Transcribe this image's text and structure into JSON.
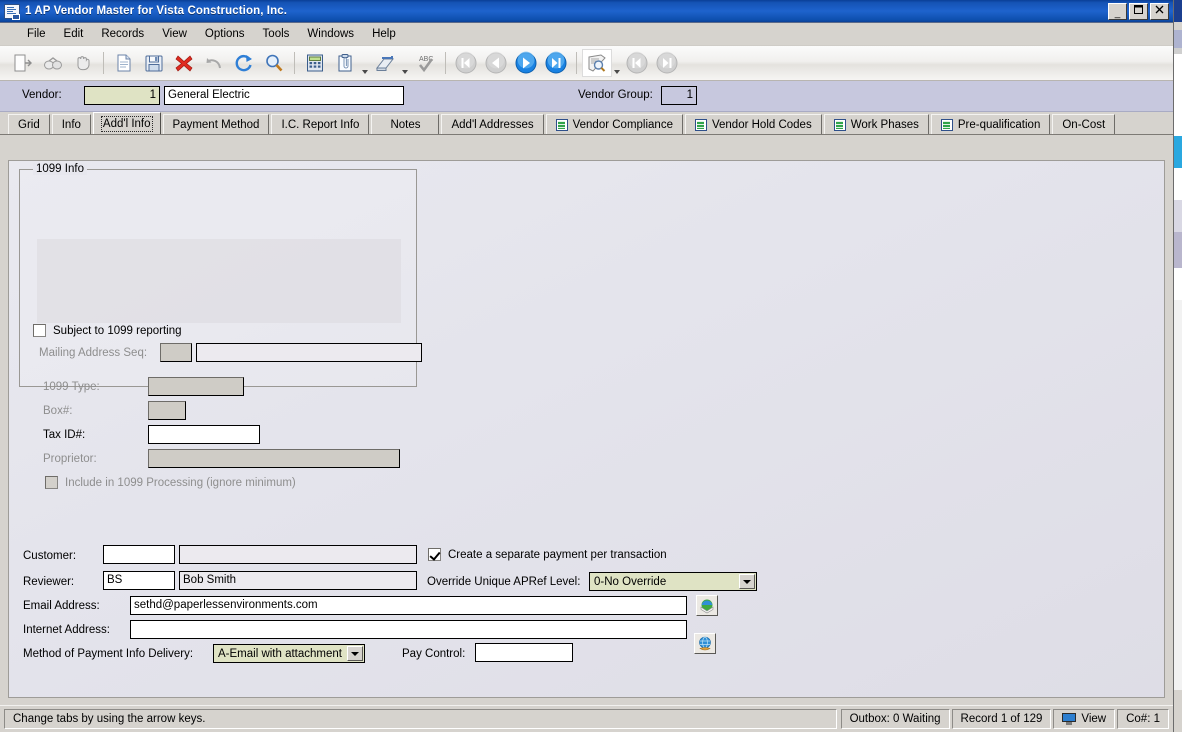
{
  "window": {
    "title": "1 AP Vendor Master for Vista Construction, Inc.",
    "icon": "form-window-icon",
    "buttons": {
      "minimize": "_",
      "maximize": "❐",
      "close": "✕"
    }
  },
  "menubar": {
    "items": [
      {
        "label": "File"
      },
      {
        "label": "Edit"
      },
      {
        "label": "Records"
      },
      {
        "label": "View"
      },
      {
        "label": "Options"
      },
      {
        "label": "Tools"
      },
      {
        "label": "Windows"
      },
      {
        "label": "Help"
      }
    ]
  },
  "toolbar": {
    "buttons": [
      {
        "name": "login-icon",
        "title": "Log In"
      },
      {
        "name": "binoculars-icon",
        "title": "Find"
      },
      {
        "name": "hand-stop-icon",
        "title": "Stop"
      },
      {
        "name": "new-document-icon",
        "title": "New"
      },
      {
        "name": "save-icon",
        "title": "Save"
      },
      {
        "name": "delete-icon",
        "title": "Delete"
      },
      {
        "name": "undo-icon",
        "title": "Undo"
      },
      {
        "name": "refresh-icon",
        "title": "Refresh"
      },
      {
        "name": "search-icon",
        "title": "Search"
      },
      {
        "name": "calculator-icon",
        "title": "Calculator"
      },
      {
        "name": "clipboard-icon",
        "title": "Notes"
      },
      {
        "name": "scanner-icon",
        "title": "Attachments"
      },
      {
        "name": "spellcheck-icon",
        "title": "Spell Check"
      },
      {
        "name": "first-record-icon",
        "title": "First Record"
      },
      {
        "name": "previous-record-icon",
        "title": "Previous Record"
      },
      {
        "name": "next-record-icon",
        "title": "Next Record"
      },
      {
        "name": "last-record-icon",
        "title": "Last Record"
      },
      {
        "name": "preview-icon",
        "title": "Preview"
      },
      {
        "name": "first-page-icon",
        "title": "First Page"
      },
      {
        "name": "last-page-icon",
        "title": "Last Page"
      }
    ]
  },
  "header": {
    "vendor_label": "Vendor:",
    "vendor_number": "1",
    "vendor_name": "General Electric",
    "vendor_group_label": "Vendor Group:",
    "vendor_group": "1"
  },
  "tabs": [
    {
      "label": "Grid",
      "icon": null,
      "active": false
    },
    {
      "label": "Info",
      "icon": null,
      "active": false
    },
    {
      "label": "Add'l Info",
      "icon": null,
      "active": true
    },
    {
      "label": "Payment Method",
      "icon": null,
      "active": false
    },
    {
      "label": "I.C. Report Info",
      "icon": null,
      "active": false
    },
    {
      "label": "Notes",
      "icon": null,
      "active": false
    },
    {
      "label": "Add'l Addresses",
      "icon": null,
      "active": false
    },
    {
      "label": "Vendor Compliance",
      "icon": "grid-tab-icon",
      "active": false
    },
    {
      "label": "Vendor Hold Codes",
      "icon": "grid-tab-icon",
      "active": false
    },
    {
      "label": "Work Phases",
      "icon": "grid-tab-icon",
      "active": false
    },
    {
      "label": "Pre-qualification",
      "icon": "grid-tab-icon",
      "active": false
    },
    {
      "label": "On-Cost",
      "icon": null,
      "active": false
    }
  ],
  "form": {
    "group_1099": {
      "title": "1099 Info",
      "subject_checkbox": {
        "label": "Subject to 1099 reporting",
        "checked": false,
        "enabled": true
      },
      "mailing_address_seq": {
        "label": "Mailing Address Seq:",
        "value": "",
        "desc": "",
        "enabled": false
      },
      "type_1099": {
        "label": "1099 Type:",
        "value": "",
        "enabled": false
      },
      "box_num": {
        "label": "Box#:",
        "value": "",
        "enabled": false
      },
      "tax_id": {
        "label": "Tax ID#:",
        "value": "",
        "enabled": true
      },
      "proprietor": {
        "label": "Proprietor:",
        "value": "",
        "enabled": false
      },
      "include_checkbox": {
        "label": "Include in 1099 Processing (ignore minimum)",
        "checked": false,
        "enabled": false
      }
    },
    "customer": {
      "label": "Customer:",
      "value": "",
      "desc": ""
    },
    "reviewer": {
      "label": "Reviewer:",
      "value": "BS",
      "desc": "Bob Smith"
    },
    "email_address": {
      "label": "Email Address:",
      "value": "sethd@paperlessenvironments.com"
    },
    "internet_address": {
      "label": "Internet Address:",
      "value": ""
    },
    "method_of_payment": {
      "label": "Method of Payment Info Delivery:",
      "value": "A-Email with attachment",
      "options": [
        "A-Email with attachment"
      ]
    },
    "pay_control": {
      "label": "Pay Control:",
      "value": ""
    },
    "separate_payment": {
      "label": "Create a separate payment per transaction",
      "checked": true
    },
    "override_apref": {
      "label": "Override Unique APRef Level:",
      "value": "0-No Override",
      "options": [
        "0-No Override"
      ]
    },
    "email_browse_button": "email-globe-icon",
    "internet_browse_button": "internet-globe-icon"
  },
  "statusbar": {
    "message": "Change tabs by using the arrow keys.",
    "outbox": "Outbox: 0 Waiting",
    "record": "Record 1 of 129",
    "view": "View",
    "view_icon": "monitor-icon",
    "company": "Co#: 1"
  },
  "colors": {
    "titlebar": "#1553b5",
    "vendorbar": "#c7c8de",
    "focus_field": "#dfe3c4",
    "chrome": "#d6d3ce"
  }
}
